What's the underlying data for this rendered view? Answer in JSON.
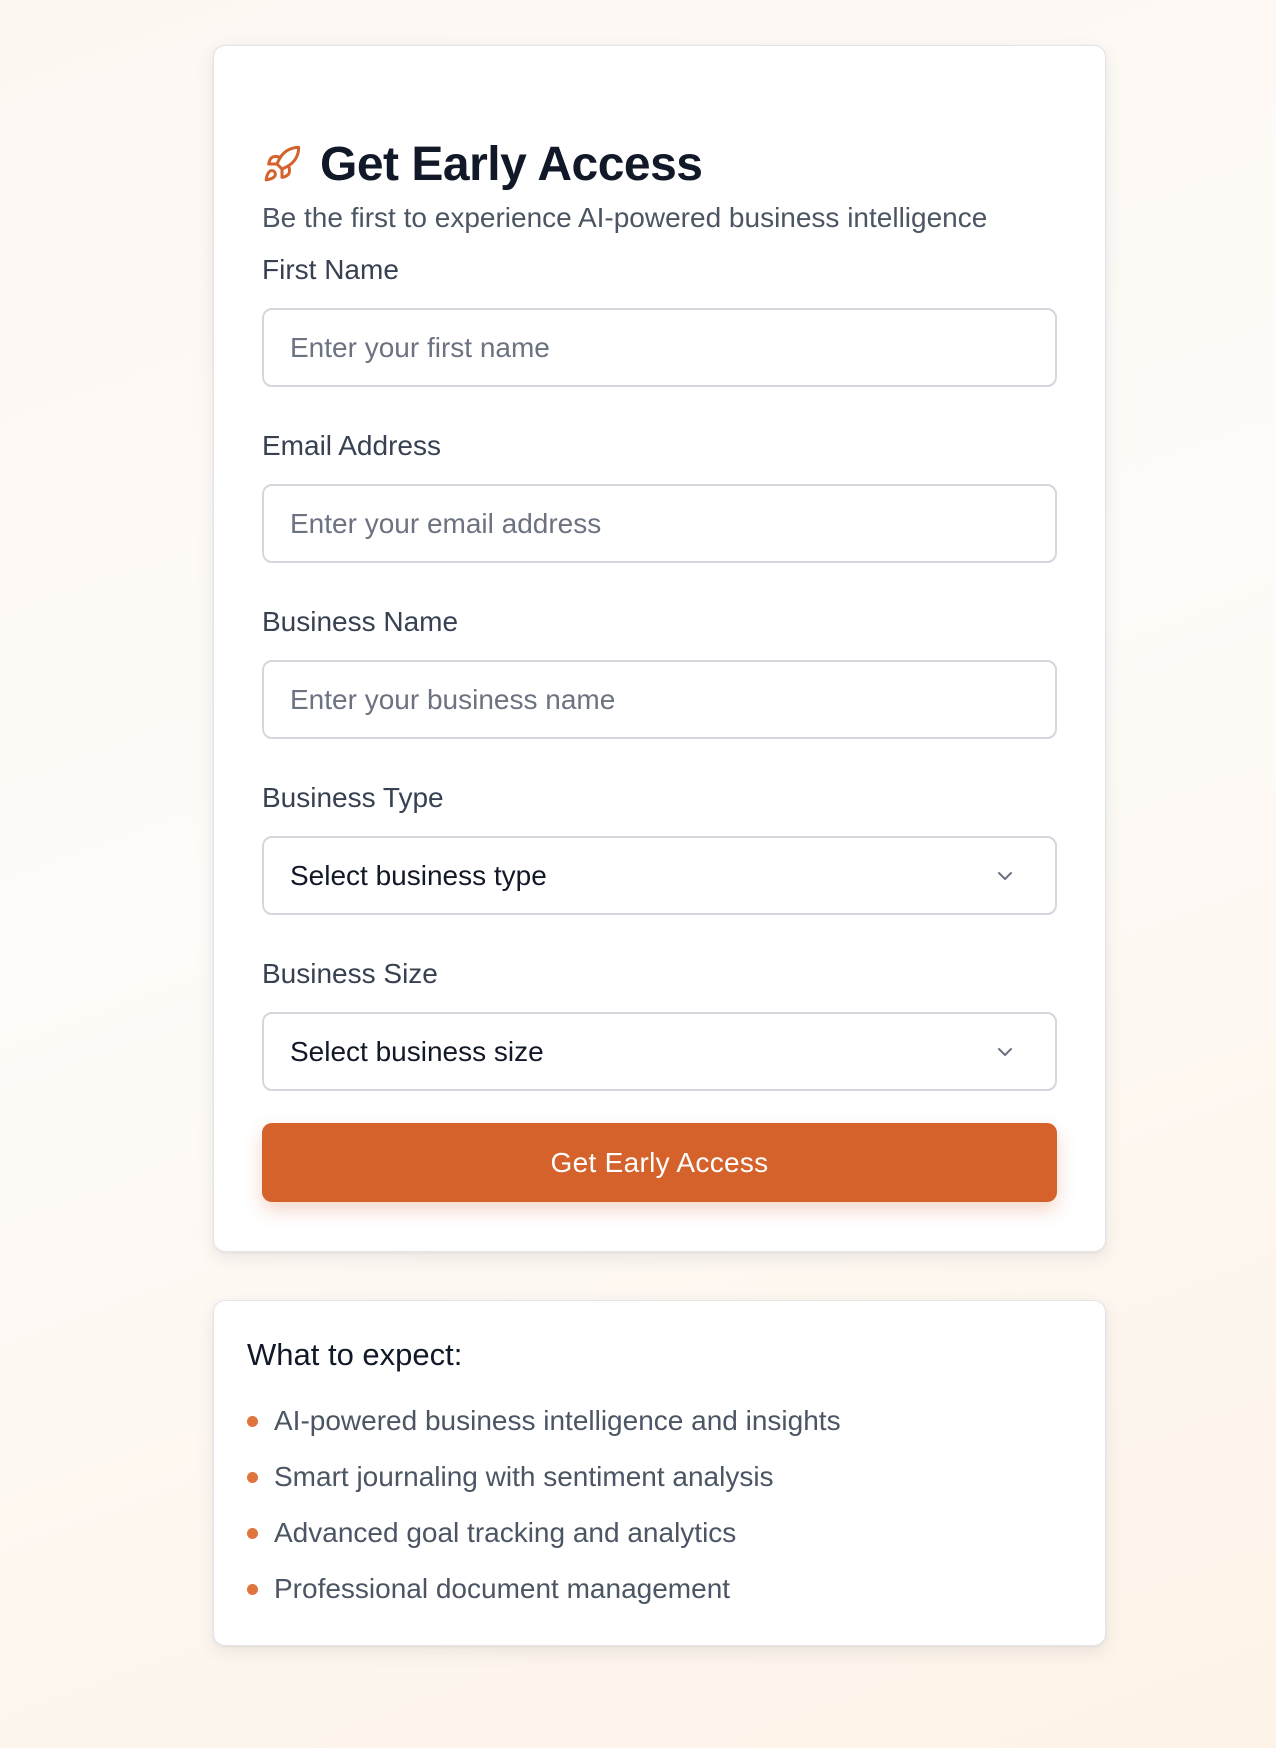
{
  "colors": {
    "accent": "#d5612b",
    "bullet": "#e0743d",
    "title": "#111827",
    "muted": "#4b5563"
  },
  "header": {
    "icon": "rocket-icon",
    "title": "Get Early Access",
    "subtitle": "Be the first to experience AI-powered business intelligence"
  },
  "form": {
    "first_name": {
      "label": "First Name",
      "placeholder": "Enter your first name",
      "value": ""
    },
    "email": {
      "label": "Email Address",
      "placeholder": "Enter your email address",
      "value": ""
    },
    "business_name": {
      "label": "Business Name",
      "placeholder": "Enter your business name",
      "value": ""
    },
    "business_type": {
      "label": "Business Type",
      "selected": "Select business type",
      "icon": "chevron-down-icon"
    },
    "business_size": {
      "label": "Business Size",
      "selected": "Select business size",
      "icon": "chevron-down-icon"
    },
    "submit_label": "Get Early Access"
  },
  "expect": {
    "title": "What to expect:",
    "items": [
      "AI-powered business intelligence and insights",
      "Smart journaling with sentiment analysis",
      "Advanced goal tracking and analytics",
      "Professional document management"
    ]
  }
}
